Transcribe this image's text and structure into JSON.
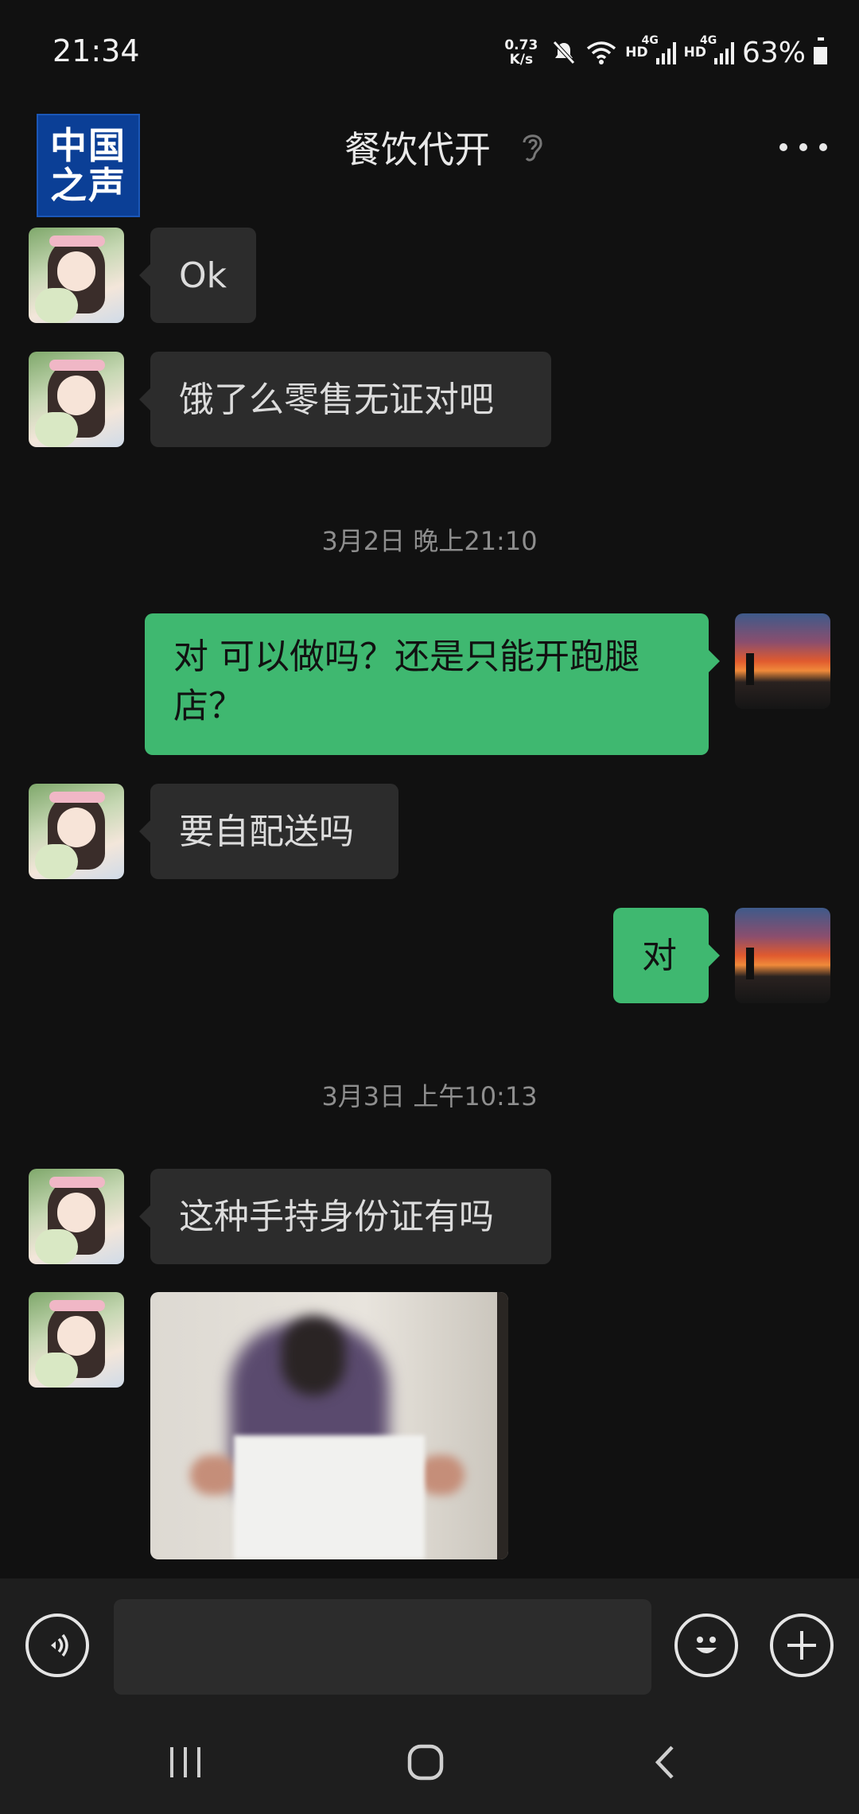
{
  "status_bar": {
    "time": "21:34",
    "net_speed_value": "0.73",
    "net_speed_unit": "K/s",
    "hd_label_1": "HD",
    "hd_label_2": "HD",
    "net_type_1": "4G",
    "net_type_2": "4G",
    "battery": "63%",
    "icons": [
      "mute-icon",
      "wifi-icon",
      "signal-icon",
      "battery-icon"
    ]
  },
  "header": {
    "logo_line1": "中国",
    "logo_line2": "之声",
    "title": "餐饮代开",
    "icons": [
      "ear-icon",
      "more-icon"
    ]
  },
  "messages": [
    {
      "side": "in",
      "text": "Ok"
    },
    {
      "side": "in",
      "text": "饿了么零售无证对吧"
    },
    {
      "type": "time",
      "text": "3月2日 晚上21:10"
    },
    {
      "side": "out",
      "line1": "对 可以做吗？还是只能开跑腿",
      "line2": "店？"
    },
    {
      "side": "in",
      "text": "要自配送吗"
    },
    {
      "side": "out",
      "text": "对"
    },
    {
      "type": "time",
      "text": "3月3日 上午10:13"
    },
    {
      "side": "in",
      "text": "这种手持身份证有吗"
    },
    {
      "side": "in",
      "type": "image"
    }
  ],
  "input_bar": {
    "message_value": "",
    "icons": [
      "voice-icon",
      "emoji-icon",
      "plus-icon"
    ]
  },
  "nav_bar": {
    "icons": [
      "recent-apps-icon",
      "home-icon",
      "back-icon"
    ]
  },
  "colors": {
    "background": "#111111",
    "incoming_bubble": "#2c2c2c",
    "outgoing_bubble": "#3fb870",
    "logo_blue": "#0b3f96"
  }
}
